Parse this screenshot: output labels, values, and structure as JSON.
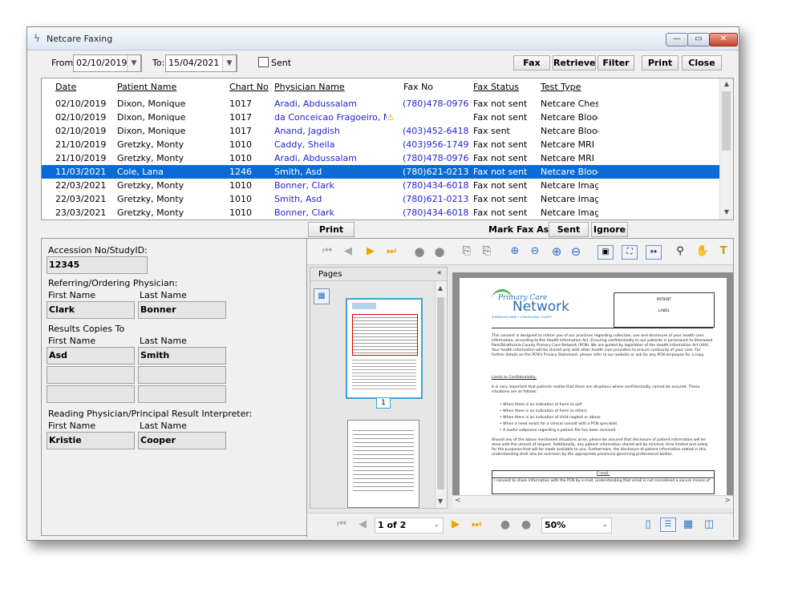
{
  "window": {
    "title": "Netcare Faxing"
  },
  "filters": {
    "from_label": "From:",
    "from_value": "02/10/2019",
    "to_label": "To:",
    "to_value": "15/04/2021",
    "sent_label": "Sent"
  },
  "toolbar": {
    "fax": "Fax",
    "retrieve": "Retrieve",
    "filter": "Filter",
    "print": "Print",
    "close": "Close"
  },
  "table": {
    "columns": [
      "Date",
      "Patient Name",
      "Chart No",
      "Physician Name",
      "Fax No",
      "Fax Status",
      "Test Type"
    ],
    "rows": [
      [
        "02/10/2019",
        "Dixon, Monique",
        "1017",
        "Aradi, Abdussalam",
        "(780)478-0976",
        "Fax not sent",
        "Netcare Chest"
      ],
      [
        "02/10/2019",
        "Dixon, Monique",
        "1017",
        "da Conceicao Fragoeiro, M",
        "",
        "Fax not sent",
        "Netcare Blood"
      ],
      [
        "02/10/2019",
        "Dixon, Monique",
        "1017",
        "Anand, Jagdish",
        "(403)452-6418",
        "Fax sent",
        "Netcare Blood"
      ],
      [
        "21/10/2019",
        "Gretzky, Monty",
        "1010",
        "Caddy, Sheila",
        "(403)956-1749",
        "Fax not sent",
        "Netcare MRI"
      ],
      [
        "21/10/2019",
        "Gretzky, Monty",
        "1010",
        "Aradi, Abdussalam",
        "(780)478-0976",
        "Fax not sent",
        "Netcare MRI"
      ],
      [
        "11/03/2021",
        "Cole, Lana",
        "1246",
        "Smith, Asd",
        "(780)621-0213",
        "Fax not sent",
        "Netcare Blood"
      ],
      [
        "22/03/2021",
        "Gretzky, Monty",
        "1010",
        "Bonner, Clark",
        "(780)434-6018",
        "Fax not sent",
        "Netcare Imagi"
      ],
      [
        "22/03/2021",
        "Gretzky, Monty",
        "1010",
        "Smith, Asd",
        "(780)621-0213",
        "Fax not sent",
        "Netcare Imagi"
      ],
      [
        "23/03/2021",
        "Gretzky, Monty",
        "1010",
        "Bonner, Clark",
        "(780)434-6018",
        "Fax not sent",
        "Netcare Imagi"
      ]
    ]
  },
  "actions": {
    "print_pdf": "Print PDF",
    "mark_fax_as": "Mark Fax As:",
    "sent": "Sent",
    "ignore": "Ignore"
  },
  "details": {
    "accession_label": "Accession No/StudyID:",
    "accession_value": "12345",
    "referring_label": "Referring/Ordering Physician:",
    "first_name_label": "First Name",
    "last_name_label": "Last Name",
    "referring_first": "Clark",
    "referring_last": "Bonner",
    "copies_label": "Results Copies To",
    "copies_first": "Asd",
    "copies_last": "Smith",
    "reading_label": "Reading Physician/Principal Result Interpreter:",
    "reading_first": "Kristie",
    "reading_last": "Cooper"
  },
  "viewer": {
    "pages_label": "Pages",
    "page_number": "1",
    "page_indicator": "1 of 2",
    "zoom": "50%",
    "doc": {
      "logo_small": "Primary Care",
      "logo_big": "Network",
      "logo_sub": "SHERWOOD PARK • STRATHCONA COUNTY",
      "patient_label": "PATIENT",
      "label_label": "LABEL",
      "intro": "This consent is designed to inform you of our practices regarding collection, use and disclosure of your health care information, according to the Health Information Act. Ensuring confidentiality to our patients is paramount to Sherwood Park/Strathcona County Primary Care Network (PCN). We are guided by legislation of the Health Information Act (HIA). Your health information will be shared only with other health care providers to ensure continuity of your care. For further details on the PCN's Privacy Statement, please refer to our website or ask for any PCN employee for a copy.",
      "limits_heading": "Limits to Confidentiality:",
      "limits_intro": "It is very important that patients realize that there are situations where confidentiality cannot be assured. These situations are as follows:",
      "bullets": [
        "When there is an indication of harm to self",
        "When there is an indication of harm to others",
        "When there is an indication of child neglect or abuse",
        "When a need exists for a clinical consult with a PCN specialist",
        "A lawful subpoena regarding a patient file has been received"
      ],
      "closing": "Should any of the above mentioned situations arise, please be assured that disclosure of patient information will be done with the utmost of respect. Additionally, any patient information shared will be minimal, time limited and solely for the purposes that will be made available to you. Furthermore, the disclosure of patient information stated in this understanding shall also be overseen by the appropriate provincial governing professional bodies.",
      "email_heading": "E-mail:",
      "email_text": "I consent to share information with the PCN by e-mail, understanding that email is not considered a secure means of"
    }
  }
}
